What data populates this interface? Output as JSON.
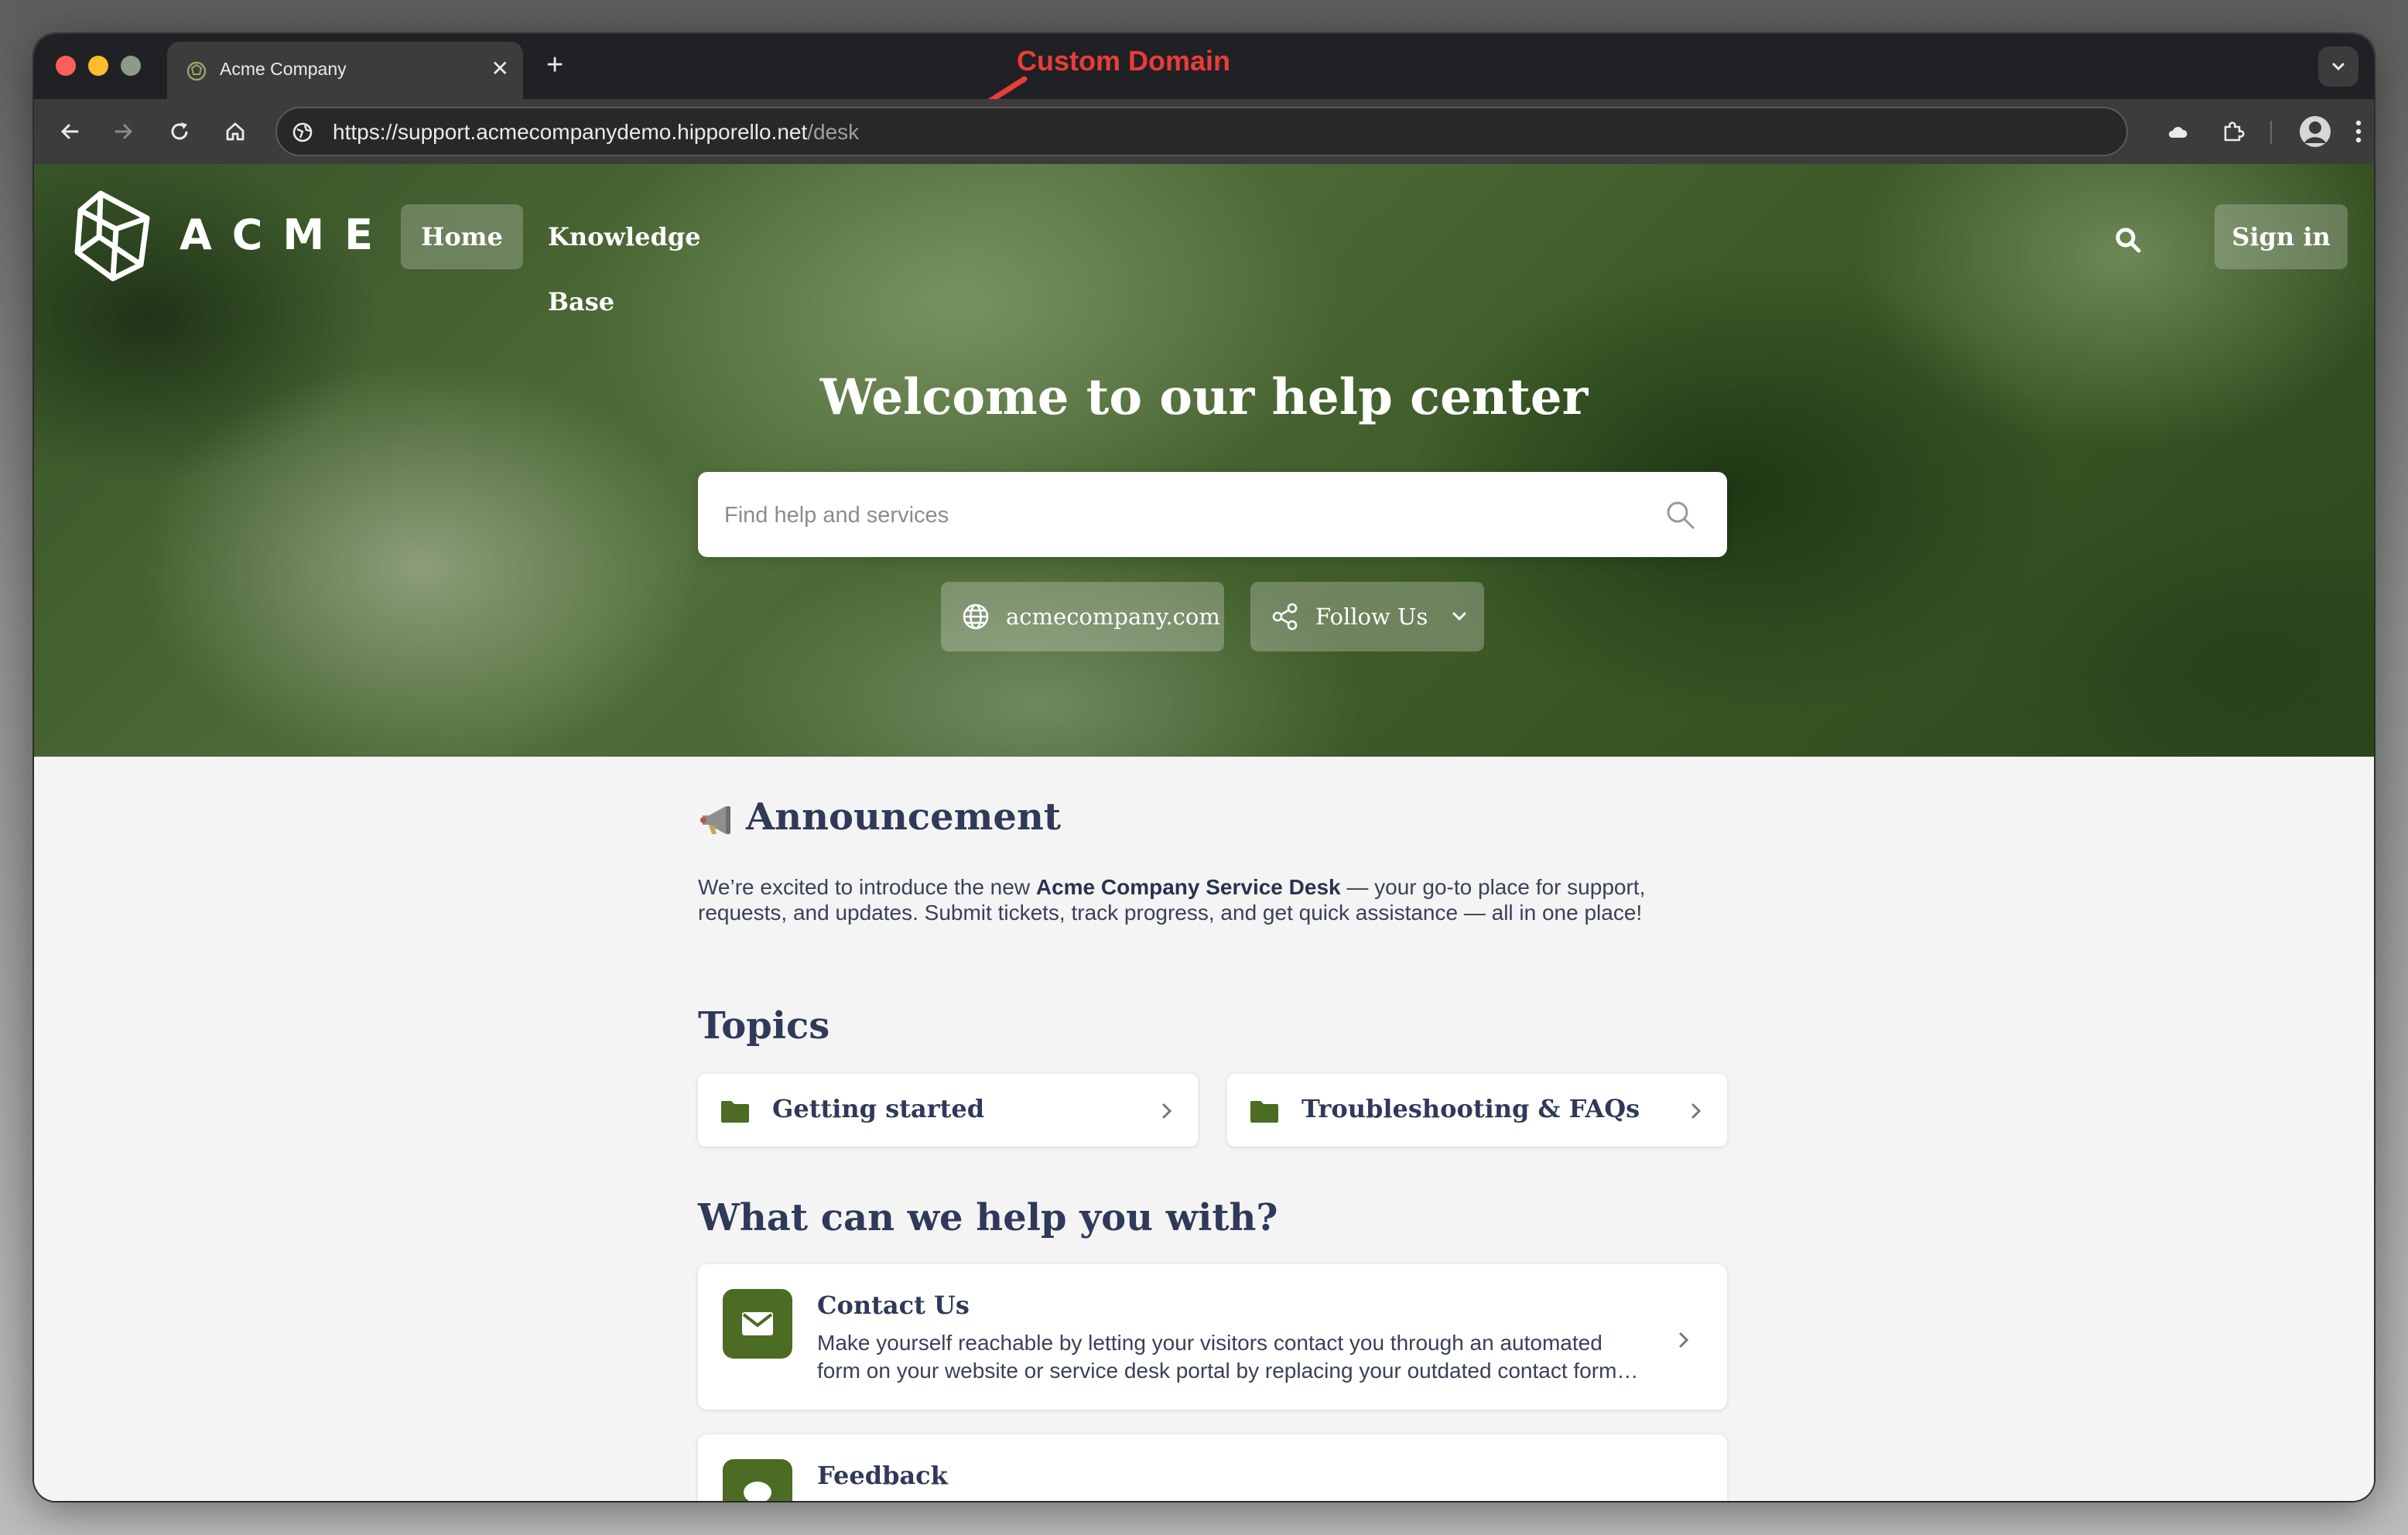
{
  "browser": {
    "tab_title": "Acme Company",
    "url_host": "https://support.acmecompanydemo.hipporello.net",
    "url_path": "/desk",
    "annotation": "Custom Domain"
  },
  "header": {
    "brand": "ACME",
    "nav": [
      "Home",
      "Knowledge Base"
    ],
    "signin_label": "Sign in"
  },
  "hero": {
    "title": "Welcome to our help center",
    "search_placeholder": "Find help and services",
    "website_label": "acmecompany.com",
    "follow_label": "Follow Us"
  },
  "announcement": {
    "title": "Announcement",
    "text_before": "We’re excited to introduce the new ",
    "text_bold": "Acme Company Service Desk",
    "text_after": " — your go-to place for support, requests, and updates. Submit tickets, track progress, and get quick assistance — all in one place!"
  },
  "topics": {
    "title": "Topics",
    "items": [
      "Getting started",
      "Troubleshooting & FAQs"
    ]
  },
  "help": {
    "title": "What can we help you with?",
    "items": [
      {
        "title": "Contact Us",
        "description": "Make yourself reachable by letting your visitors contact you through an automated form on your website or service desk portal by replacing your outdated contact forms and emails."
      },
      {
        "title": "Feedback",
        "description": ""
      }
    ]
  },
  "colors": {
    "accent": "#4c6b23",
    "heading": "#2f3a5a",
    "annotation": "#ea3c39"
  }
}
